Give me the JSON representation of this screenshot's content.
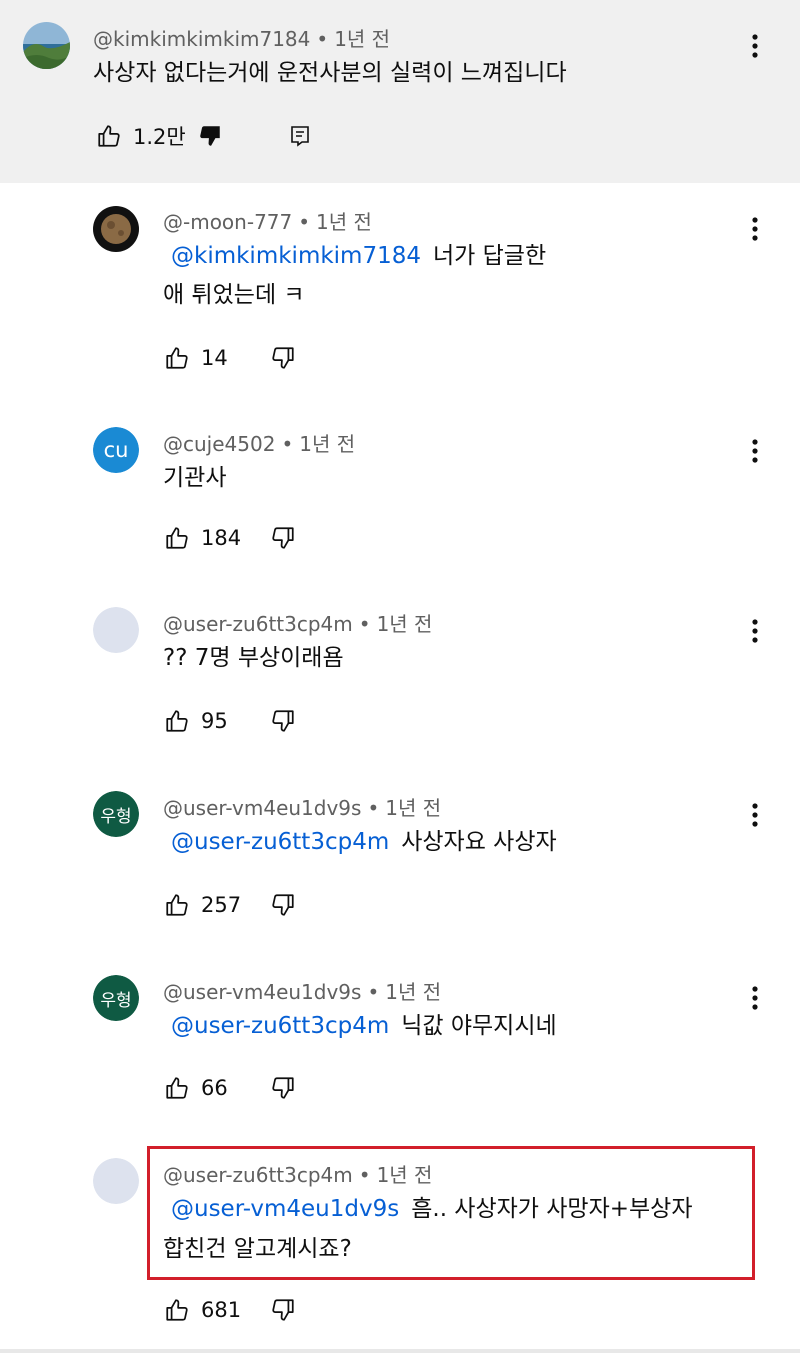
{
  "parent": {
    "handle": "@kimkimkimkim7184",
    "time": "1년 전",
    "text": "사상자 없다는거에 운전사분의 실력이 느껴집니다",
    "likes": "1.2만",
    "icons": {
      "like": "thumbs-up-icon",
      "dislike": "thumbs-down-filled-icon",
      "reply": "reply-comment-icon",
      "more": "more-vert-icon"
    }
  },
  "replies": [
    {
      "handle": "@-moon-777",
      "time": "1년 전",
      "mention": "@kimkimkimkim7184",
      "line1": "너가 답글한",
      "line2": "애 튀었는데 ㅋ",
      "likes": "14",
      "avatar_label": "",
      "avatar_color": "#111111"
    },
    {
      "handle": "@cuje4502",
      "time": "1년 전",
      "mention": "",
      "line1": "기관사",
      "line2": "",
      "likes": "184",
      "avatar_label": "cu",
      "avatar_color": "#1a8ad4"
    },
    {
      "handle": "@user-zu6tt3cp4m",
      "time": "1년 전",
      "mention": "",
      "line1": "?? 7명 부상이래욤",
      "line2": "",
      "likes": "95",
      "avatar_label": "",
      "avatar_color": "#dde2ee"
    },
    {
      "handle": "@user-vm4eu1dv9s",
      "time": "1년 전",
      "mention": "@user-zu6tt3cp4m",
      "line1": "사상자요 사상자",
      "line2": "",
      "likes": "257",
      "avatar_label": "우형",
      "avatar_color": "#0f5a43"
    },
    {
      "handle": "@user-vm4eu1dv9s",
      "time": "1년 전",
      "mention": "@user-zu6tt3cp4m",
      "line1": "닉값 야무지시네",
      "line2": "",
      "likes": "66",
      "avatar_label": "우형",
      "avatar_color": "#0f5a43"
    },
    {
      "handle": "@user-zu6tt3cp4m",
      "time": "1년 전",
      "mention": "@user-vm4eu1dv9s",
      "line1": "흠.. 사상자가 사망자+부상자",
      "line2": "합친건 알고계시죠?",
      "likes": "681",
      "avatar_label": "",
      "avatar_color": "#dde2ee"
    }
  ],
  "separator": "•",
  "highlight_color": "#d21f2a",
  "mention_color": "#065fd4"
}
